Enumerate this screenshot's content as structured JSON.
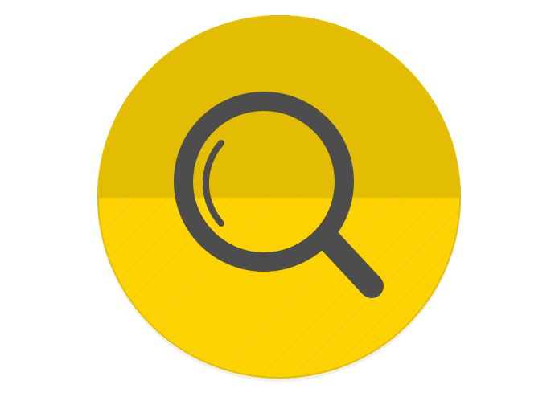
{
  "icon": {
    "name": "search-icon",
    "colors": {
      "background": "#ffffff",
      "circle_top": "#e3bd03",
      "circle_bottom": "#fdd303",
      "rim": "#e6c000",
      "magnifier": "#4d4d4d",
      "stripes": "#c9a800"
    }
  }
}
